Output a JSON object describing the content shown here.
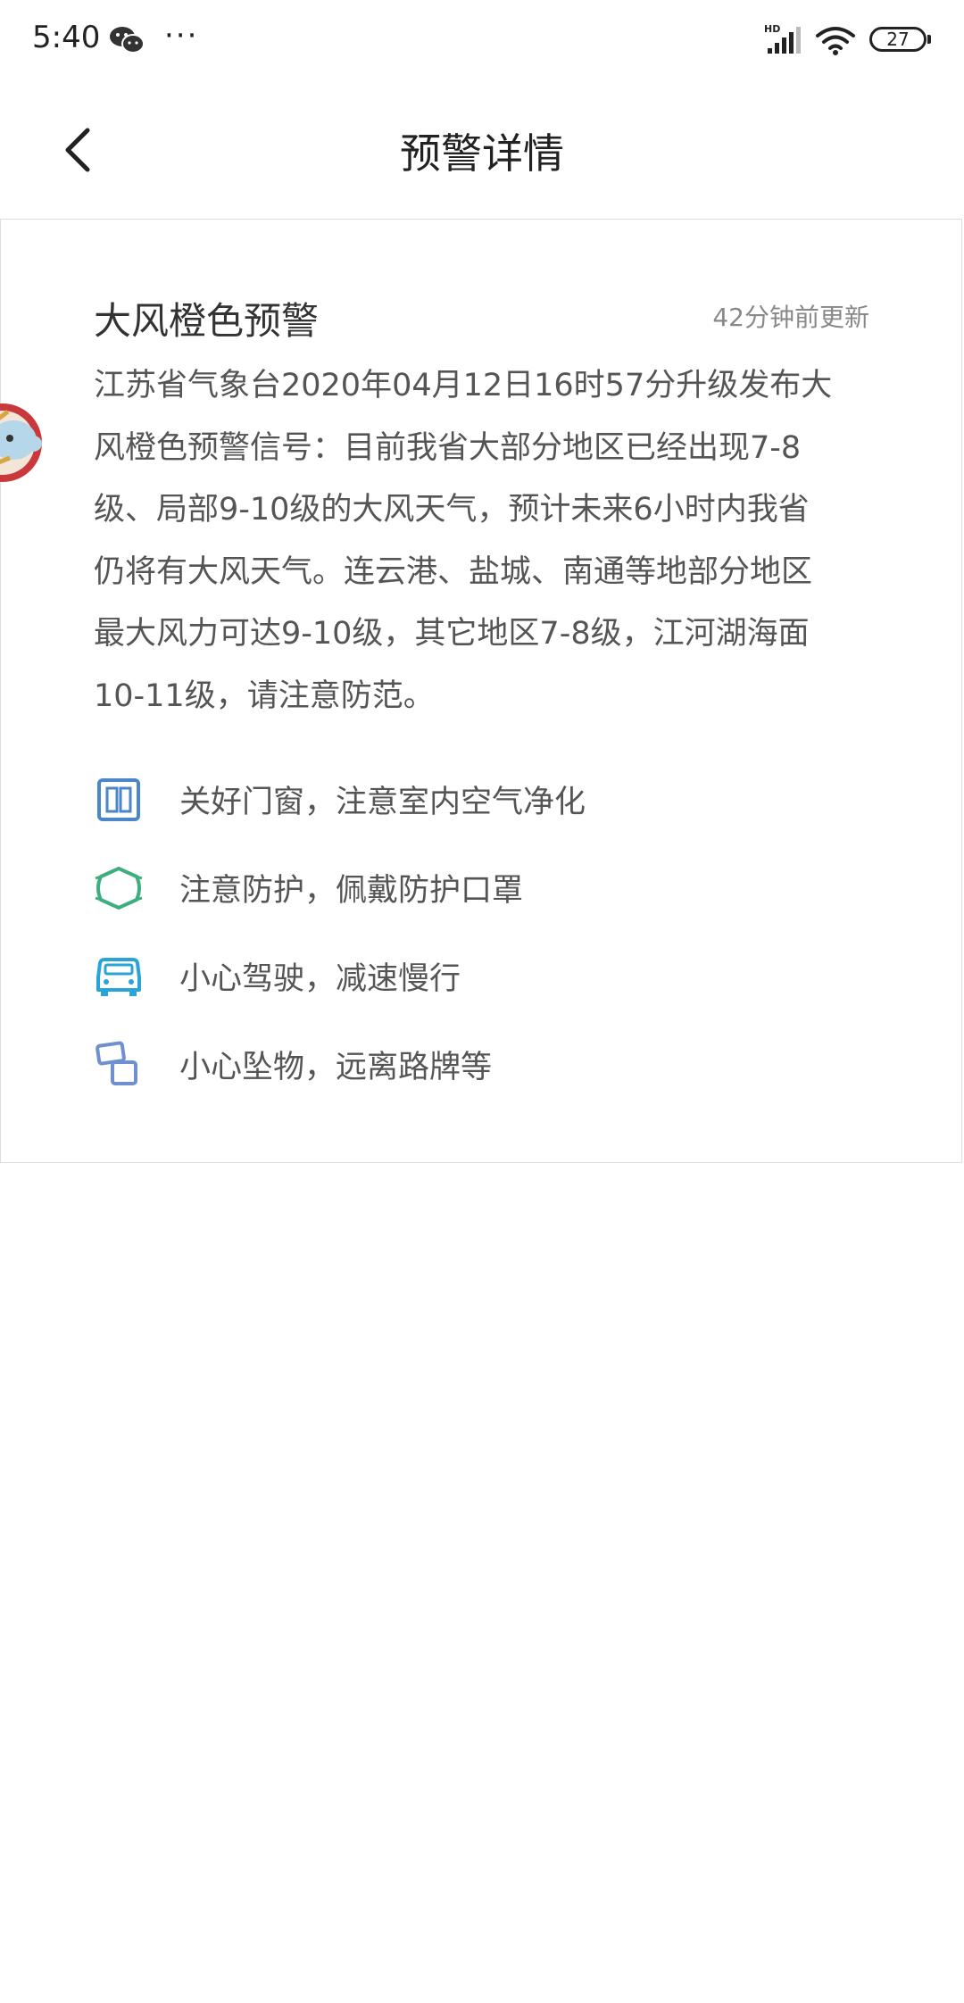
{
  "status_bar": {
    "time": "5:40",
    "more": "···",
    "network": "HD",
    "battery": "27",
    "icons": [
      "wechat-icon",
      "signal-icon",
      "wifi-icon",
      "battery-icon"
    ]
  },
  "header": {
    "title": "预警详情",
    "back_icon": "chevron-left-icon"
  },
  "warning": {
    "title": "大风橙色预警",
    "updated": "42分钟前更新",
    "lines": [
      "江苏省气象台2020年04月12日16时57分升级发布大",
      "风橙色预警信号：目前我省大部分地区已经出现7-8",
      "级、局部9-10级的大风天气，预计未来6小时内我省",
      "仍将有大风天气。连云港、盐城、南通等地部分地区",
      "最大风力可达9-10级，其它地区7-8级，江河湖海面",
      "10-11级，请注意防范。"
    ]
  },
  "tips": [
    {
      "icon": "window-icon",
      "color": "#4a86c8",
      "text": "关好门窗，注意室内空气净化"
    },
    {
      "icon": "mask-icon",
      "color": "#3fae7f",
      "text": "注意防护，佩戴防护口罩"
    },
    {
      "icon": "car-icon",
      "color": "#2aa3d6",
      "text": "小心驾驶，减速慢行"
    },
    {
      "icon": "falling-objects-icon",
      "color": "#6e8fd0",
      "text": "小心坠物，远离路牌等"
    }
  ]
}
